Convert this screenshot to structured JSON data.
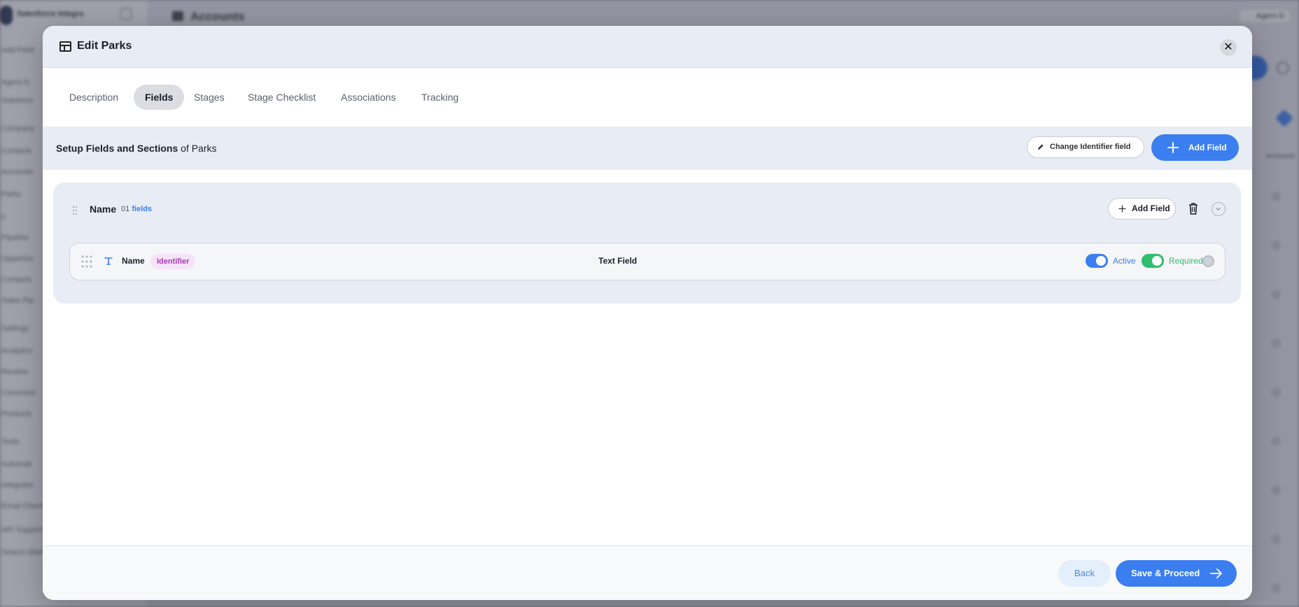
{
  "background": {
    "brand": "Salesforce Integra",
    "header_title": "Accounts",
    "agent_label": "Agent G",
    "nav_items": [
      "Add Field",
      "Agent G",
      "Solutions",
      "Company",
      "Contacts",
      "Accounts",
      "Parks",
      "s",
      "Pipeline",
      "Opportun",
      "Contacts",
      "Sales Pip",
      "Settings",
      "Analytics",
      "Routine",
      "Commissi",
      "Products",
      "Tools",
      "Automati",
      "Integratio",
      "Email Check",
      "API Support",
      "Search Mark"
    ],
    "column_header": "Accounts"
  },
  "modal": {
    "title": "Edit Parks",
    "close_label": "✕",
    "tabs": [
      {
        "label": "Description",
        "active": false
      },
      {
        "label": "Fields",
        "active": true
      },
      {
        "label": "Stages",
        "active": false
      },
      {
        "label": "Stage Checklist",
        "active": false
      },
      {
        "label": "Associations",
        "active": false
      },
      {
        "label": "Tracking",
        "active": false
      }
    ],
    "setup": {
      "title_bold": "Setup Fields and Sections",
      "title_suffix": "of Parks",
      "change_identifier_label": "Change Identifier field",
      "add_field_label": "Add Field"
    },
    "section": {
      "name": "Name",
      "count": "01",
      "count_suffix": "fields",
      "add_field_label": "Add Field",
      "fields": [
        {
          "name": "Name",
          "tag": "Identifier",
          "type": "Text Field",
          "active_label": "Active",
          "active": true,
          "required_label": "Required",
          "required": true
        }
      ]
    },
    "footer": {
      "back_label": "Back",
      "save_label": "Save & Proceed"
    }
  },
  "colors": {
    "primary": "#3b7ef0",
    "success": "#2fbd6e",
    "identifier_tag_bg": "#f6e3f8",
    "identifier_tag_text": "#a43db0",
    "panel_bg": "#e8edf5"
  },
  "icons": [
    "layout-icon",
    "close-icon",
    "pencil-icon",
    "plus-icon",
    "drag-handle-icon",
    "trash-icon",
    "chevron-down-icon",
    "grip-icon",
    "text-type-icon",
    "more-icon",
    "arrow-right-icon"
  ]
}
